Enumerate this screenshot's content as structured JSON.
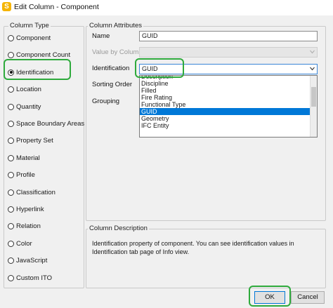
{
  "window": {
    "title": "Edit Column - Component",
    "app_icon_letter": "S"
  },
  "column_type": {
    "legend": "Column Type",
    "options": [
      {
        "label": "Component",
        "selected": false
      },
      {
        "label": "Component Count",
        "selected": false
      },
      {
        "label": "Identification",
        "selected": true
      },
      {
        "label": "Location",
        "selected": false
      },
      {
        "label": "Quantity",
        "selected": false
      },
      {
        "label": "Space Boundary Areas",
        "selected": false
      },
      {
        "label": "Property Set",
        "selected": false
      },
      {
        "label": "Material",
        "selected": false
      },
      {
        "label": "Profile",
        "selected": false
      },
      {
        "label": "Classification",
        "selected": false
      },
      {
        "label": "Hyperlink",
        "selected": false
      },
      {
        "label": "Relation",
        "selected": false
      },
      {
        "label": "Color",
        "selected": false
      },
      {
        "label": "JavaScript",
        "selected": false
      },
      {
        "label": "Custom ITO",
        "selected": false
      }
    ]
  },
  "attributes": {
    "legend": "Column Attributes",
    "name_label": "Name",
    "name_value": "GUID",
    "value_by_column_label": "Value by Column",
    "identification_label": "Identification",
    "identification_value": "GUID",
    "sorting_order_label": "Sorting Order",
    "grouping_label": "Grouping",
    "dropdown_options": [
      "Description",
      "Discipline",
      "Filled",
      "Fire Rating",
      "Functional Type",
      "GUID",
      "Geometry",
      "IFC Entity"
    ],
    "dropdown_selected": "GUID"
  },
  "description": {
    "legend": "Column Description",
    "text": "Identification property of component. You can see identification values in Identification tab page of Info view."
  },
  "buttons": {
    "ok": "OK",
    "cancel": "Cancel"
  },
  "colors": {
    "highlight": "#2eaa3c",
    "selection": "#0078d7",
    "app_icon": "#f5b400"
  }
}
